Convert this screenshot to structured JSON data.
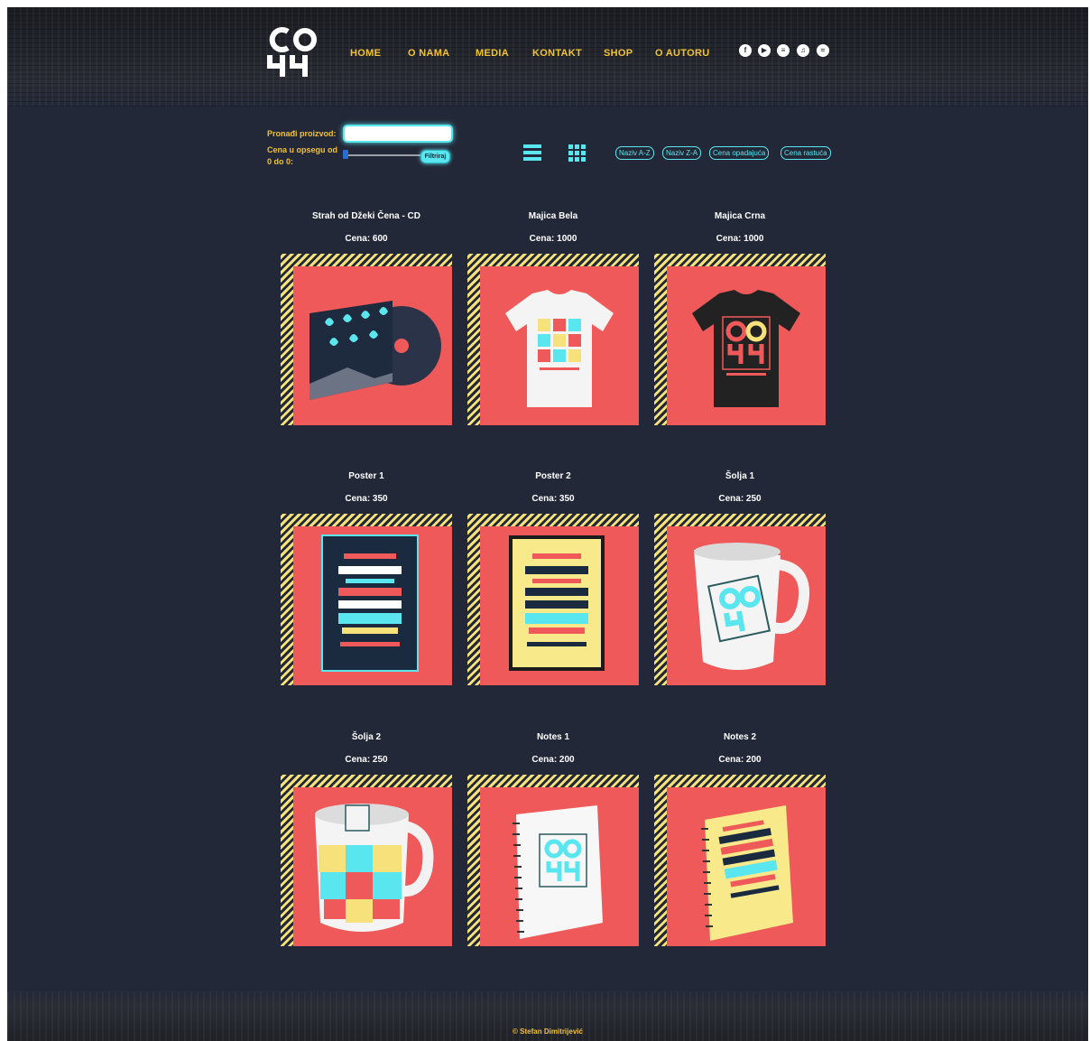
{
  "nav": {
    "items": [
      "HOME",
      "O NAMA",
      "MEDIA",
      "KONTAKT",
      "SHOP",
      "O AUTORU"
    ]
  },
  "social": [
    "facebook-icon",
    "youtube-icon",
    "deezer-icon",
    "apple-music-icon",
    "spotify-icon"
  ],
  "filters": {
    "search_label": "Pronađi proizvod:",
    "range_label_1": "Cena u opsegu od",
    "range_label_2": "0 do 0:",
    "filter_button": "Filtriraj",
    "search_value": ""
  },
  "sort": [
    "Naziv A-Z",
    "Naziv Z-A",
    "Cena opadajuća",
    "Cena rastuća"
  ],
  "products": [
    {
      "title": "Strah od Džeki Čena - CD",
      "price": "Cena: 600",
      "kind": "cd"
    },
    {
      "title": "Majica Bela",
      "price": "Cena: 1000",
      "kind": "shirt-white"
    },
    {
      "title": "Majica Crna",
      "price": "Cena: 1000",
      "kind": "shirt-black"
    },
    {
      "title": "Poster 1",
      "price": "Cena: 350",
      "kind": "poster-dark"
    },
    {
      "title": "Poster 2",
      "price": "Cena: 350",
      "kind": "poster-light"
    },
    {
      "title": "Šolja 1",
      "price": "Cena: 250",
      "kind": "mug-white"
    },
    {
      "title": "Šolja 2",
      "price": "Cena: 250",
      "kind": "mug-color"
    },
    {
      "title": "Notes 1",
      "price": "Cena: 200",
      "kind": "notes-white"
    },
    {
      "title": "Notes 2",
      "price": "Cena: 200",
      "kind": "notes-yellow"
    }
  ],
  "colors": {
    "background": "#232838",
    "accent_yellow": "#f1c232",
    "accent_cyan": "#5ae6ee",
    "card_red": "#f05959",
    "stripe": "#f6e17a"
  },
  "footer": {
    "copyright": "© Stefan Dimitrijević"
  }
}
